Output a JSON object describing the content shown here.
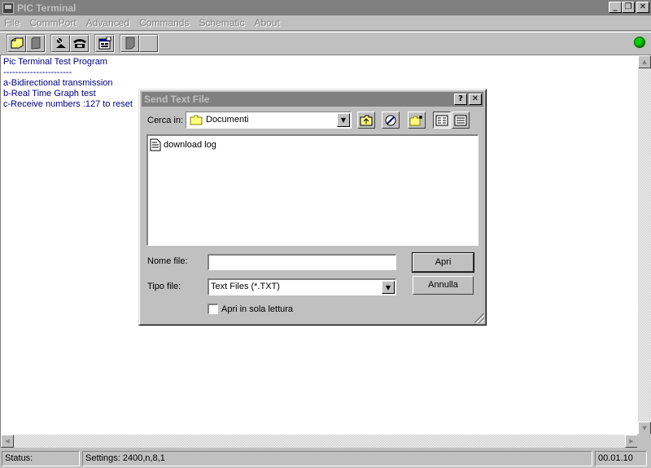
{
  "window": {
    "title": "PIC Terminal"
  },
  "titlebar_buttons": {
    "minimize": "_",
    "maximize": "❐",
    "close": "✕"
  },
  "menu": [
    "File",
    "CommPort",
    "Advanced",
    "Commands",
    "Schematic",
    "About"
  ],
  "toolbar": {
    "groups": [
      [
        "open-icon",
        "new-icon"
      ],
      [
        "connect-icon",
        "phone-icon"
      ],
      [
        "properties-icon"
      ],
      [
        "document-icon",
        "blank-icon"
      ]
    ],
    "status_led_color": "#00d000"
  },
  "terminal": {
    "lines": [
      "Pic Terminal Test Program",
      "-----------------------",
      "a-Bidirectional transmission",
      "b-Real Time Graph test",
      "c-Receive numbers :127 to reset"
    ],
    "text_color": "#000080"
  },
  "statusbar": {
    "status": "Status:",
    "settings": "Settings: 2400,n,8,1",
    "time": "00.01.10"
  },
  "dialog": {
    "title": "Send Text File",
    "help_btn": "?",
    "close_btn": "✕",
    "look_in_label": "Cerca in:",
    "look_in_value": "Documenti",
    "files": [
      "download log"
    ],
    "filename_label": "Nome file:",
    "filename_value": "",
    "filetype_label": "Tipo file:",
    "filetype_value": "Text Files (*.TXT)",
    "open_button": "Apri",
    "cancel_button": "Annulla",
    "readonly_label": "Apri in sola lettura",
    "readonly_checked": false
  }
}
